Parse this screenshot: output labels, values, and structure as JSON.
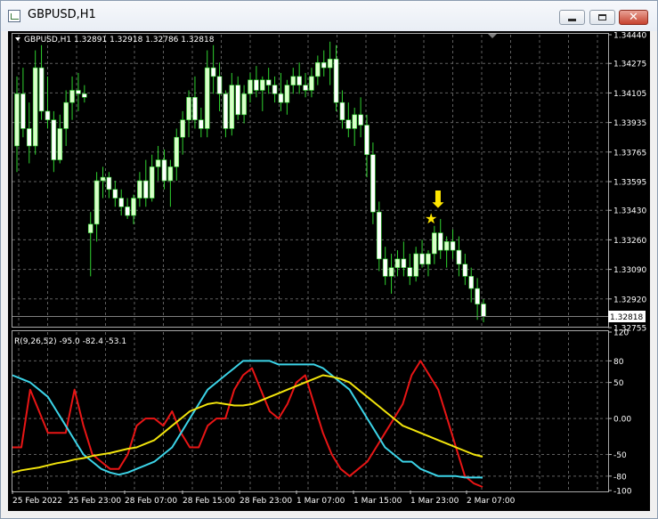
{
  "window": {
    "title": "GBPUSD,H1",
    "controls": {
      "minimize": "–",
      "maximize": "□",
      "close": "✕"
    }
  },
  "price_panel": {
    "header": "GBPUSD,H1  1.32891 1.32918 1.32786 1.32818",
    "current_price": "1.32818",
    "price_ticks": [
      "1.34440",
      "1.34275",
      "1.34105",
      "1.33935",
      "1.33765",
      "1.33595",
      "1.33430",
      "1.33260",
      "1.33090",
      "1.32920",
      "1.32755"
    ],
    "signal_star": "★",
    "signal_arrow": "⬇"
  },
  "indicator_panel": {
    "header": "R(9,26,52) -95.0 -82.4 -53.1",
    "value_ticks": [
      "120",
      "80",
      "50",
      "0.00",
      "-50",
      "-80",
      "-100"
    ]
  },
  "time_axis": {
    "labels": [
      "25 Feb 2022",
      "25 Feb 23:00",
      "28 Feb 07:00",
      "28 Feb 15:00",
      "28 Feb 23:00",
      "1 Mar 07:00",
      "1 Mar 15:00",
      "1 Mar 23:00",
      "2 Mar 07:00"
    ]
  },
  "colors": {
    "background": "#000000",
    "grid": "#5f5f5f",
    "bull_candle": "#d8ffc9",
    "bear_candle": "#ffffff",
    "candle_wick": "#2fd22f",
    "indicator_red": "#e81515",
    "indicator_cyan": "#3cd4e8",
    "indicator_yellow": "#f2e40c",
    "signal": "#ffe600"
  },
  "chart_data": [
    {
      "type": "candlestick",
      "symbol": "GBPUSD",
      "timeframe": "H1",
      "ylim": [
        1.32755,
        1.3444
      ],
      "last": {
        "open": 1.32891,
        "high": 1.32918,
        "low": 1.32786,
        "close": 1.32818
      },
      "ohlc": [
        [
          1.338,
          1.342,
          1.3365,
          1.341
        ],
        [
          1.341,
          1.3425,
          1.3385,
          1.339
        ],
        [
          1.339,
          1.3405,
          1.337,
          1.338
        ],
        [
          1.338,
          1.3435,
          1.3375,
          1.3425
        ],
        [
          1.3425,
          1.3438,
          1.3395,
          1.34
        ],
        [
          1.34,
          1.342,
          1.339,
          1.3395
        ],
        [
          1.3395,
          1.34,
          1.3365,
          1.3372
        ],
        [
          1.3372,
          1.3398,
          1.337,
          1.339
        ],
        [
          1.339,
          1.3412,
          1.338,
          1.3405
        ],
        [
          1.3405,
          1.342,
          1.3395,
          1.3412
        ],
        [
          1.3412,
          1.3422,
          1.34,
          1.341
        ],
        [
          1.341,
          1.3415,
          1.3405,
          1.3408
        ],
        [
          1.333,
          1.3342,
          1.3305,
          1.3335
        ],
        [
          1.3335,
          1.3365,
          1.3325,
          1.336
        ],
        [
          1.336,
          1.3368,
          1.335,
          1.3362
        ],
        [
          1.3362,
          1.3365,
          1.335,
          1.3355
        ],
        [
          1.3355,
          1.336,
          1.3345,
          1.335
        ],
        [
          1.335,
          1.3355,
          1.334,
          1.3345
        ],
        [
          1.3345,
          1.335,
          1.3338,
          1.334
        ],
        [
          1.334,
          1.3352,
          1.3335,
          1.335
        ],
        [
          1.335,
          1.3365,
          1.3345,
          1.336
        ],
        [
          1.336,
          1.3372,
          1.3345,
          1.335
        ],
        [
          1.335,
          1.3375,
          1.3348,
          1.3368
        ],
        [
          1.3368,
          1.338,
          1.336,
          1.3372
        ],
        [
          1.3372,
          1.3378,
          1.3355,
          1.336
        ],
        [
          1.336,
          1.3372,
          1.3345,
          1.3368
        ],
        [
          1.3368,
          1.339,
          1.336,
          1.3385
        ],
        [
          1.3385,
          1.34,
          1.3375,
          1.3395
        ],
        [
          1.3395,
          1.3412,
          1.3385,
          1.3408
        ],
        [
          1.3408,
          1.342,
          1.339,
          1.3395
        ],
        [
          1.3395,
          1.3402,
          1.3385,
          1.339
        ],
        [
          1.339,
          1.3435,
          1.3385,
          1.3425
        ],
        [
          1.3425,
          1.3438,
          1.341,
          1.342
        ],
        [
          1.342,
          1.3428,
          1.34,
          1.341
        ],
        [
          1.341,
          1.3412,
          1.3385,
          1.339
        ],
        [
          1.339,
          1.3422,
          1.3386,
          1.3415
        ],
        [
          1.3415,
          1.342,
          1.3395,
          1.3398
        ],
        [
          1.3398,
          1.3415,
          1.3393,
          1.341
        ],
        [
          1.341,
          1.3422,
          1.3405,
          1.3418
        ],
        [
          1.3418,
          1.3426,
          1.3408,
          1.3412
        ],
        [
          1.3412,
          1.342,
          1.34,
          1.3418
        ],
        [
          1.3418,
          1.3425,
          1.341,
          1.3415
        ],
        [
          1.3415,
          1.342,
          1.3405,
          1.341
        ],
        [
          1.341,
          1.3422,
          1.34,
          1.3405
        ],
        [
          1.3405,
          1.3418,
          1.3398,
          1.3415
        ],
        [
          1.3415,
          1.3425,
          1.341,
          1.342
        ],
        [
          1.342,
          1.3428,
          1.341,
          1.3415
        ],
        [
          1.3415,
          1.3422,
          1.3408,
          1.3412
        ],
        [
          1.3412,
          1.3425,
          1.3408,
          1.342
        ],
        [
          1.342,
          1.3432,
          1.3415,
          1.3428
        ],
        [
          1.3428,
          1.3435,
          1.342,
          1.3425
        ],
        [
          1.3425,
          1.344,
          1.3415,
          1.343
        ],
        [
          1.343,
          1.3438,
          1.34,
          1.3405
        ],
        [
          1.3405,
          1.3412,
          1.339,
          1.3395
        ],
        [
          1.3395,
          1.3405,
          1.3385,
          1.339
        ],
        [
          1.339,
          1.3402,
          1.338,
          1.3398
        ],
        [
          1.3398,
          1.3408,
          1.3385,
          1.3392
        ],
        [
          1.3392,
          1.3398,
          1.3362,
          1.3375
        ],
        [
          1.3375,
          1.3382,
          1.3335,
          1.3342
        ],
        [
          1.3342,
          1.3348,
          1.3308,
          1.3315
        ],
        [
          1.3315,
          1.3322,
          1.33,
          1.3305
        ],
        [
          1.3305,
          1.3318,
          1.3295,
          1.331
        ],
        [
          1.331,
          1.332,
          1.3305,
          1.3315
        ],
        [
          1.3315,
          1.3325,
          1.3305,
          1.331
        ],
        [
          1.331,
          1.3318,
          1.33,
          1.3305
        ],
        [
          1.3305,
          1.3322,
          1.3302,
          1.3318
        ],
        [
          1.3318,
          1.3326,
          1.331,
          1.3312
        ],
        [
          1.3312,
          1.332,
          1.3305,
          1.3318
        ],
        [
          1.3318,
          1.3334,
          1.3312,
          1.333
        ],
        [
          1.333,
          1.3338,
          1.3315,
          1.332
        ],
        [
          1.332,
          1.3328,
          1.331,
          1.3325
        ],
        [
          1.3325,
          1.3332,
          1.3315,
          1.332
        ],
        [
          1.332,
          1.3328,
          1.3305,
          1.3312
        ],
        [
          1.3312,
          1.3318,
          1.33,
          1.3305
        ],
        [
          1.3305,
          1.331,
          1.329,
          1.3298
        ],
        [
          1.3298,
          1.3304,
          1.328,
          1.3289
        ],
        [
          1.32891,
          1.32918,
          1.32786,
          1.32818
        ]
      ]
    },
    {
      "type": "line",
      "title": "R(9,26,52)",
      "ylim": [
        -100,
        120
      ],
      "last_values": [
        -95.0,
        -82.4,
        -53.1
      ],
      "series": [
        {
          "color": "#e81515",
          "values": [
            -40,
            -40,
            40,
            10,
            -20,
            -20,
            -20,
            40,
            -10,
            -50,
            -60,
            -70,
            -70,
            -50,
            -10,
            0,
            0,
            -10,
            10,
            -20,
            -40,
            -40,
            -10,
            0,
            0,
            40,
            60,
            70,
            40,
            10,
            0,
            20,
            50,
            60,
            20,
            -20,
            -50,
            -70,
            -80,
            -70,
            -60,
            -40,
            -20,
            0,
            20,
            60,
            80,
            60,
            40,
            0,
            -40,
            -80,
            -90,
            -95
          ]
        },
        {
          "color": "#3cd4e8",
          "values": [
            60,
            55,
            50,
            40,
            30,
            10,
            -10,
            -30,
            -50,
            -60,
            -70,
            -75,
            -78,
            -75,
            -70,
            -65,
            -60,
            -50,
            -40,
            -20,
            0,
            20,
            40,
            50,
            60,
            70,
            80,
            80,
            80,
            80,
            75,
            75,
            75,
            75,
            75,
            70,
            60,
            50,
            40,
            20,
            0,
            -20,
            -40,
            -50,
            -60,
            -60,
            -70,
            -75,
            -80,
            -80,
            -80,
            -82,
            -82,
            -82
          ]
        },
        {
          "color": "#f2e40c",
          "values": [
            -75,
            -72,
            -70,
            -68,
            -65,
            -62,
            -60,
            -57,
            -55,
            -52,
            -50,
            -48,
            -45,
            -42,
            -40,
            -35,
            -30,
            -20,
            -10,
            0,
            10,
            15,
            20,
            22,
            20,
            18,
            18,
            20,
            25,
            30,
            35,
            40,
            45,
            50,
            55,
            60,
            58,
            55,
            50,
            40,
            30,
            20,
            10,
            0,
            -10,
            -15,
            -20,
            -25,
            -30,
            -35,
            -40,
            -45,
            -50,
            -53
          ]
        }
      ]
    }
  ]
}
